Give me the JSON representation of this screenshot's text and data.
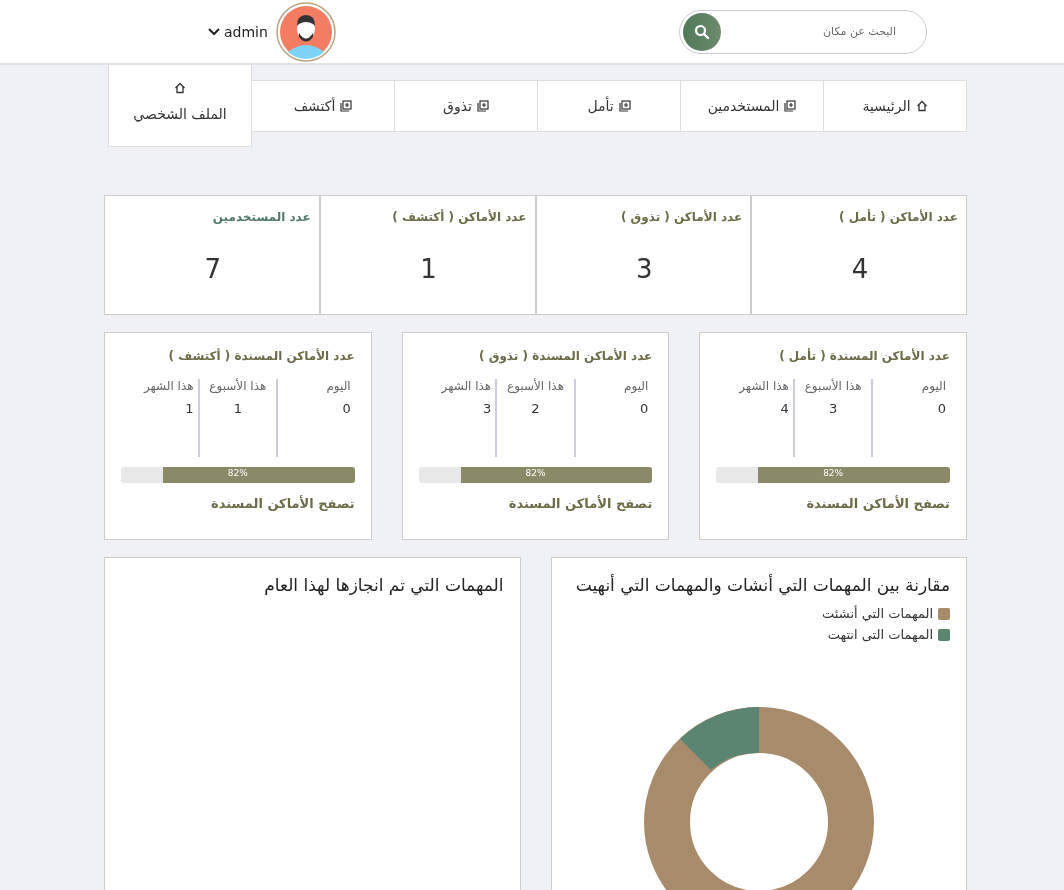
{
  "header": {
    "search": {
      "placeholder": "البحث عن مكان"
    },
    "user": {
      "name": "admin"
    }
  },
  "nav": [
    {
      "label": "الرئيسية",
      "kind": "home",
      "selected": false
    },
    {
      "label": "المستخدمين",
      "kind": "plus",
      "selected": false
    },
    {
      "label": "تأمل",
      "kind": "plus",
      "selected": false
    },
    {
      "label": "تذوق",
      "kind": "plus",
      "selected": false
    },
    {
      "label": "أكتشف",
      "kind": "plus",
      "selected": false
    },
    {
      "label": "الملف الشخصي",
      "kind": "home",
      "selected": true
    }
  ],
  "counts": [
    {
      "title": "عدد الأماكن ( تأمل )",
      "value": "4",
      "color": "#6b6b47"
    },
    {
      "title": "عدد الأماكن ( تذوق )",
      "value": "3",
      "color": "#6b6b47"
    },
    {
      "title": "عدد الأماكن ( أكتشف )",
      "value": "1",
      "color": "#6b6b47"
    },
    {
      "title": "عدد المستخدمين",
      "value": "7",
      "color": "#4f7a6a"
    }
  ],
  "assigned": [
    {
      "title": "عدد الأماكن المسندة ( تأمل )",
      "stats": [
        {
          "label": "اليوم",
          "value": "0"
        },
        {
          "label": "هذا الأسبوع",
          "value": "3"
        },
        {
          "label": "هذا الشهر",
          "value": "4"
        }
      ],
      "level": 0.82,
      "percent": "82%",
      "link": "تصفح الأماكن المسندة"
    },
    {
      "title": "عدد الأماكن المسندة ( تذوق )",
      "stats": [
        {
          "label": "اليوم",
          "value": "0"
        },
        {
          "label": "هذا الأسبوع",
          "value": "2"
        },
        {
          "label": "هذا الشهر",
          "value": "3"
        }
      ],
      "level": 0.82,
      "percent": "82%",
      "link": "تصفح الأماكن المسندة"
    },
    {
      "title": "عدد الأماكن المسندة ( أكتشف )",
      "stats": [
        {
          "label": "اليوم",
          "value": "0"
        },
        {
          "label": "هذا الأسبوع",
          "value": "1"
        },
        {
          "label": "هذا الشهر",
          "value": "1"
        }
      ],
      "level": 0.82,
      "percent": "82%",
      "link": "تصفح الأماكن المسندة"
    }
  ],
  "charts": [
    {
      "title": "مقارنة بين المهمات التي أنشات والمهمات التي أنهيت",
      "legend": [
        {
          "label": "المهمات التي أنشئت",
          "color": "#a88b6b"
        },
        {
          "label": "المهمات التى انتهت",
          "color": "#5a8570"
        }
      ]
    },
    {
      "title": "المهمات التي تم انجازها لهذا العام"
    }
  ]
}
